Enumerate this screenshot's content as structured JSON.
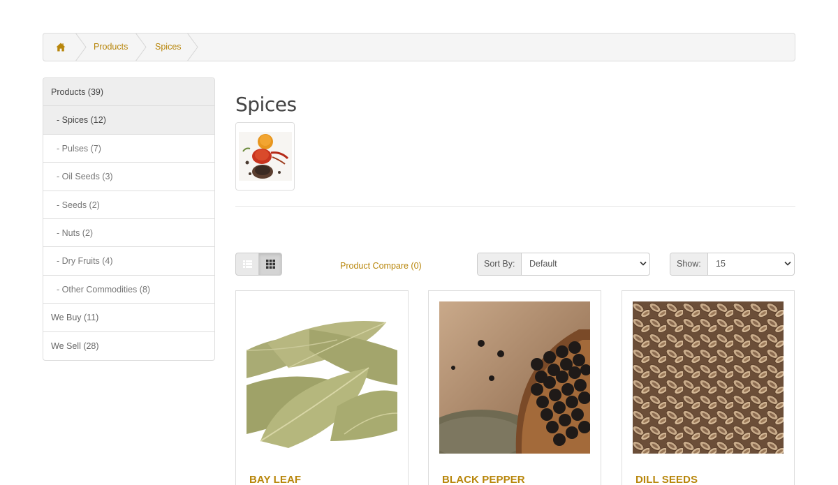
{
  "breadcrumb": {
    "home_icon": "home-icon",
    "items": [
      {
        "label": "Products"
      },
      {
        "label": "Spices"
      }
    ]
  },
  "sidebar": {
    "items": [
      {
        "label": "Products (39)"
      },
      {
        "label": "- Spices (12)"
      },
      {
        "label": "- Pulses (7)"
      },
      {
        "label": "- Oil Seeds (3)"
      },
      {
        "label": "- Seeds (2)"
      },
      {
        "label": "- Nuts (2)"
      },
      {
        "label": "- Dry Fruits (4)"
      },
      {
        "label": "- Other Commodities (8)"
      },
      {
        "label": "We Buy (11)"
      },
      {
        "label": "We Sell (28)"
      }
    ]
  },
  "main": {
    "title": "Spices"
  },
  "toolbar": {
    "list_view_icon": "list-view-icon",
    "grid_view_icon": "grid-view-icon",
    "compare_label": "Product Compare (0)",
    "sort_label": "Sort By:",
    "sort_value": "Default",
    "show_label": "Show:",
    "show_value": "15"
  },
  "products": [
    {
      "name": "BAY LEAF"
    },
    {
      "name": "BLACK PEPPER"
    },
    {
      "name": "DILL SEEDS"
    }
  ],
  "colors": {
    "accent": "#b8860b",
    "border": "#dddddd",
    "breadcrumb_bg": "#f5f5f5"
  }
}
